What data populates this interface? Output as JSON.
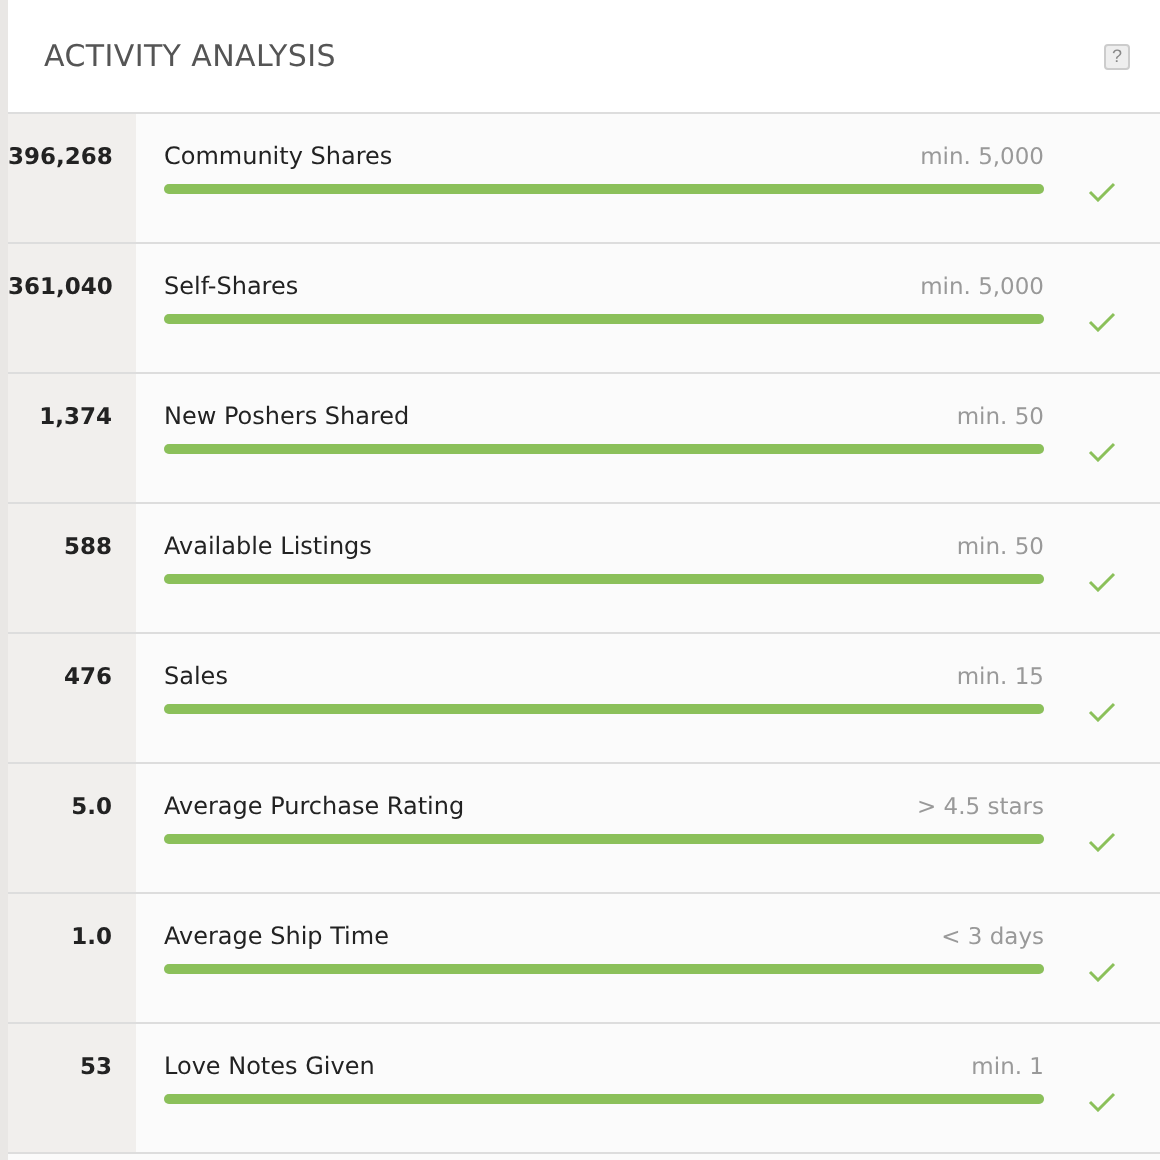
{
  "header": {
    "title": "ACTIVITY ANALYSIS",
    "help": "?"
  },
  "metrics": [
    {
      "value": "396,268",
      "name": "Community Shares",
      "requirement": "min. 5,000",
      "level": 1,
      "met": true
    },
    {
      "value": "361,040",
      "name": "Self-Shares",
      "requirement": "min. 5,000",
      "level": 1,
      "met": true
    },
    {
      "value": "1,374",
      "name": "New Poshers Shared",
      "requirement": "min. 50",
      "level": 1,
      "met": true
    },
    {
      "value": "588",
      "name": "Available Listings",
      "requirement": "min. 50",
      "level": 1,
      "met": true
    },
    {
      "value": "476",
      "name": "Sales",
      "requirement": "min. 15",
      "level": 1,
      "met": true
    },
    {
      "value": "5.0",
      "name": "Average Purchase Rating",
      "requirement": "> 4.5 stars",
      "level": 1,
      "met": true
    },
    {
      "value": "1.0",
      "name": "Average Ship Time",
      "requirement": "< 3 days",
      "level": 1,
      "met": true
    },
    {
      "value": "53",
      "name": "Love Notes Given",
      "requirement": "min. 1",
      "level": 1,
      "met": true
    }
  ]
}
